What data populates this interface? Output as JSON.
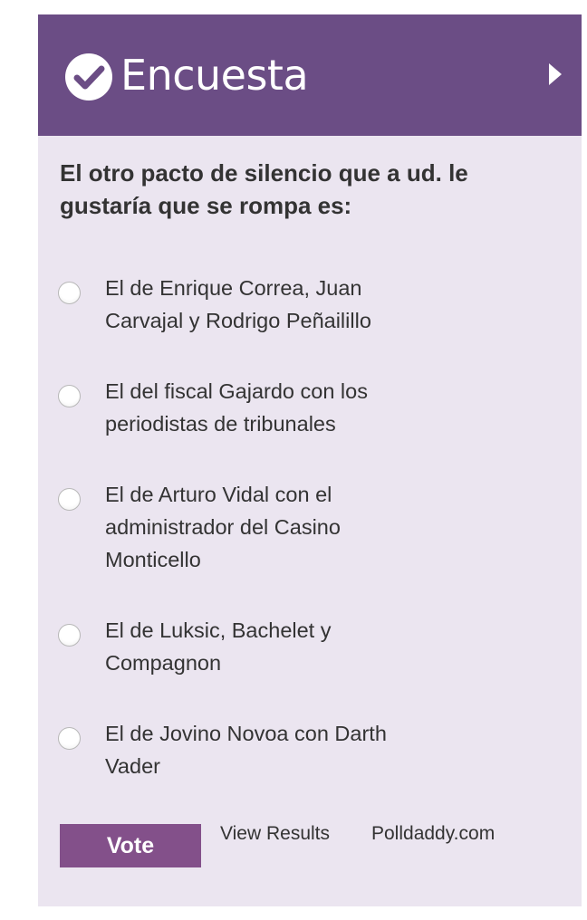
{
  "header": {
    "title": "Encuesta",
    "check_icon": "check-circle-icon",
    "next_icon": "triangle-right-icon"
  },
  "poll": {
    "question": "El otro pacto de silencio que a ud. le gustaría que se rompa es:",
    "options": [
      {
        "label": "El de Enrique Correa, Juan Carvajal y Rodrigo Peñailillo",
        "selected": false
      },
      {
        "label": "El del fiscal Gajardo con los periodistas de tribunales",
        "selected": false
      },
      {
        "label": "El de Arturo Vidal con el administrador del Casino Monticello",
        "selected": false
      },
      {
        "label": "El de Luksic, Bachelet y Compagnon",
        "selected": false
      },
      {
        "label": "El de Jovino Novoa con Darth Vader",
        "selected": false
      }
    ]
  },
  "footer": {
    "vote_label": "Vote",
    "results_label": "View Results",
    "brand_label": "Polldaddy.com"
  },
  "colors": {
    "header_bg": "#6b4d85",
    "body_bg": "#ebe5f0",
    "vote_bg": "#83508a",
    "text": "#333333"
  }
}
